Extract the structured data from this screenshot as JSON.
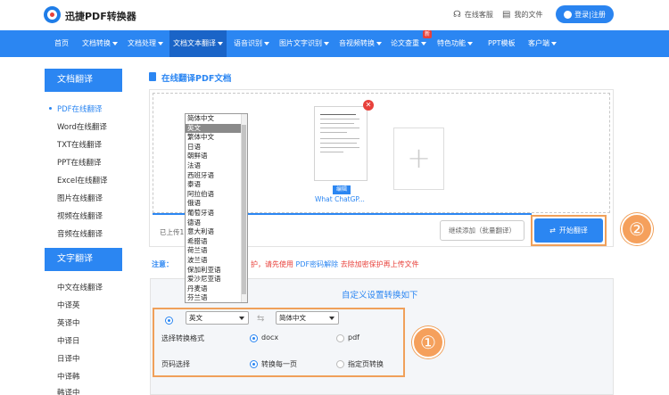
{
  "header": {
    "logo_text": "迅捷PDF转换器",
    "service_label": "在线客服",
    "files_label": "我的文件",
    "login_label": "登录|注册"
  },
  "nav": {
    "items": [
      "首页",
      "文档转换",
      "文档处理",
      "文档文本翻译",
      "语音识别",
      "图片文字识别",
      "音视频转换",
      "论文查重",
      "特色功能",
      "PPT模板",
      "客户端"
    ],
    "badge": "新"
  },
  "sidebar": {
    "section1_title": "文档翻译",
    "section1_items": [
      "PDF在线翻译",
      "Word在线翻译",
      "TXT在线翻译",
      "PPT在线翻译",
      "Excel在线翻译",
      "图片在线翻译",
      "视频在线翻译",
      "音频在线翻译"
    ],
    "section2_title": "文字翻译",
    "section2_items": [
      "中文在线翻译",
      "中译英",
      "英译中",
      "中译日",
      "日译中",
      "中译韩",
      "韩译中"
    ]
  },
  "main": {
    "title": "在线翻译PDF文档",
    "file_name": "What ChatGP...",
    "edit_label": "编辑",
    "uploaded_text": "已上传1",
    "continue_button": "继续添加（批量翻译）",
    "start_button": "开始翻译",
    "notice_prefix": "注意：",
    "notice_mid": "护，请先使用",
    "notice_link": "PDF密码解除",
    "notice_suffix": "去除加密保护再上传文件",
    "settings_title": "自定义设置转换如下",
    "source_lang": "英文",
    "target_lang": "简体中文",
    "format_label": "选择转换格式",
    "format_docx": "docx",
    "format_pdf": "pdf",
    "page_label": "页码选择",
    "page_all": "转换每一页",
    "page_specific": "指定页转换"
  },
  "language_dropdown": {
    "options": [
      "简体中文",
      "英文",
      "繁体中文",
      "日语",
      "朝鲜语",
      "法语",
      "西班牙语",
      "泰语",
      "阿拉伯语",
      "俄语",
      "葡萄牙语",
      "德语",
      "意大利语",
      "希腊语",
      "荷兰语",
      "波兰语",
      "保加利亚语",
      "爱沙尼亚语",
      "丹麦语",
      "芬兰语"
    ],
    "selected": "英文"
  },
  "callouts": {
    "one": "①",
    "two": "②"
  },
  "colors": {
    "primary": "#2b86f2",
    "danger": "#e8413b",
    "callout": "#f0a05a"
  }
}
